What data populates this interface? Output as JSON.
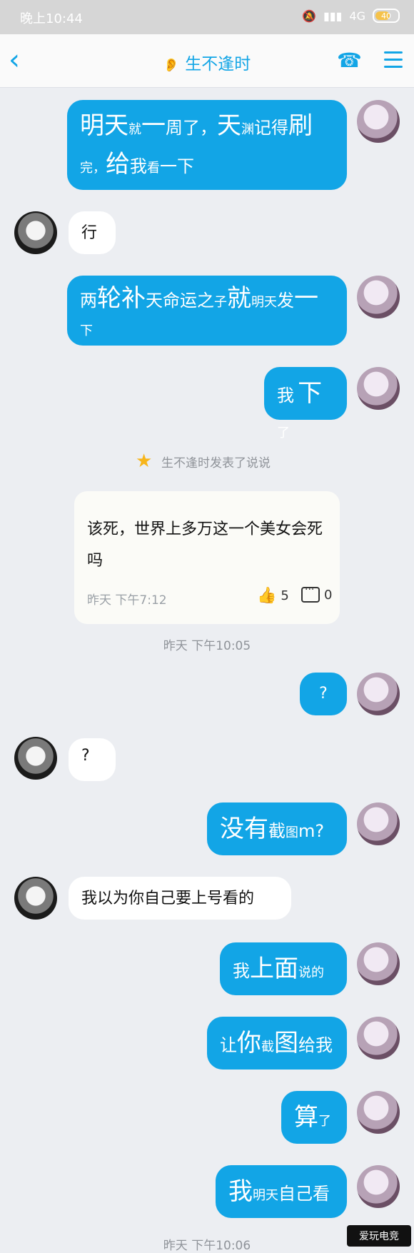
{
  "status": {
    "time": "晚上10:44",
    "network": "4G",
    "battery": "40"
  },
  "header": {
    "title": "生不逢时"
  },
  "feed": {
    "note": "生不逢时发表了说说",
    "post_text": "该死，世界上多万这一个美女会死吗",
    "post_time": "昨天 下午7:12",
    "likes": "5",
    "comments": "0"
  },
  "timestamps": {
    "t1": "昨天 下午10:05",
    "t2": "昨天 下午10:06"
  },
  "messages": {
    "m1_a": "明天",
    "m1_b": "就",
    "m1_c": "一",
    "m1_d": "周了，",
    "m1_e": "天",
    "m1_f": "渊",
    "m1_g": "记得",
    "m1_h": "刷",
    "m1_i": "完，",
    "m1_j": "给",
    "m1_k": "我",
    "m1_l": "看",
    "m1_m": "一下",
    "m2": "行",
    "m3_a": "两",
    "m3_b": "轮补",
    "m3_c": "天命运之",
    "m3_d": "子",
    "m3_e": "就",
    "m3_f": "明天",
    "m3_g": "发",
    "m3_h": "一",
    "m3_i": "下",
    "m4_a": "我",
    "m4_b": "下",
    "m4_c": "了",
    "m5": "?",
    "m6": "?",
    "m7_a": "没有",
    "m7_b": "截",
    "m7_c": "图",
    "m7_d": "m?",
    "m8": "我以为你自己要上号看的",
    "m9_a": "我",
    "m9_b": "上面",
    "m9_c": "说的",
    "m10_a": "让",
    "m10_b": "你",
    "m10_c": "截",
    "m10_d": "图",
    "m10_e": "给我",
    "m11_a": "算",
    "m11_b": "了",
    "m12_a": "我",
    "m12_b": "明天",
    "m12_c": "自己看"
  },
  "watermark": "爱玩电竞"
}
